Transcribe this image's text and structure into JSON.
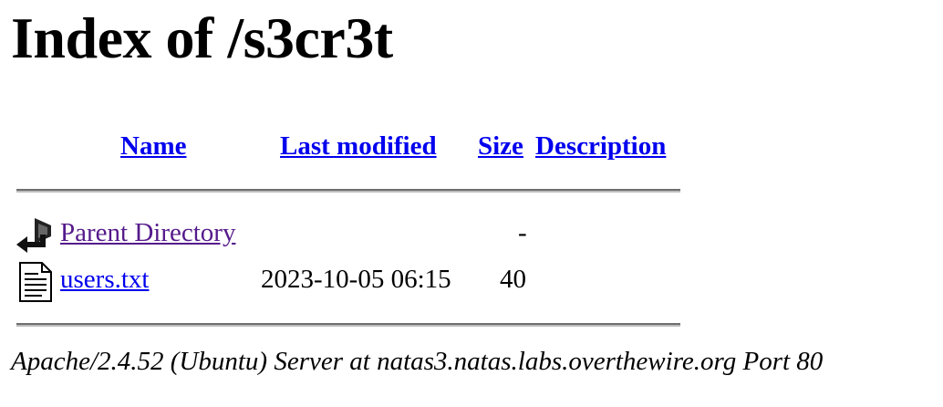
{
  "page": {
    "title": "Index of /s3cr3t"
  },
  "table": {
    "headers": {
      "name": "Name",
      "modified": "Last modified",
      "size": "Size",
      "description": "Description"
    },
    "rows": [
      {
        "name": "Parent Directory",
        "modified": "",
        "size": "-",
        "description": "",
        "icon": "back-arrow-icon"
      },
      {
        "name": "users.txt",
        "modified": "2023-10-05 06:15",
        "size": "40",
        "description": "",
        "icon": "text-file-icon"
      }
    ]
  },
  "footer": {
    "server_signature": "Apache/2.4.52 (Ubuntu) Server at natas3.natas.labs.overthewire.org Port 80"
  },
  "colors": {
    "link": "#0000ee",
    "visited_link": "#551a8b"
  }
}
